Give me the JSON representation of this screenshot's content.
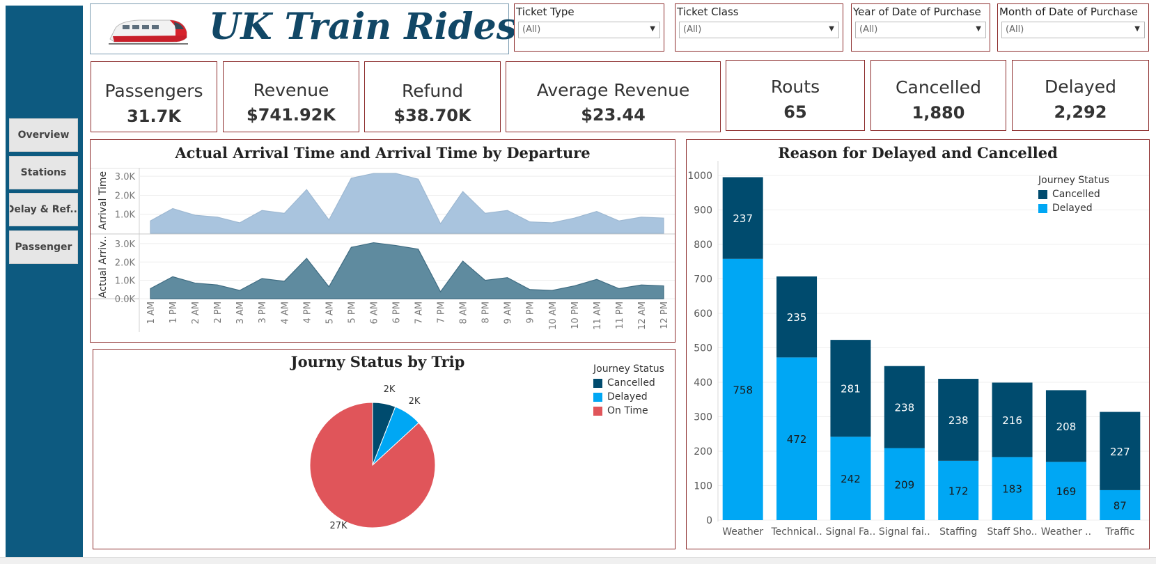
{
  "nav": {
    "items": [
      {
        "label": "Overview"
      },
      {
        "label": "Stations"
      },
      {
        "label": "Delay & Ref..."
      },
      {
        "label": "Passenger"
      }
    ]
  },
  "header": {
    "title": "UK Train Rides"
  },
  "filters": [
    {
      "label": "Ticket Type",
      "value": "(All)"
    },
    {
      "label": "Ticket Class",
      "value": "(All)"
    },
    {
      "label": "Year of Date of Purchase",
      "value": "(All)"
    },
    {
      "label": "Month of Date of Purchase",
      "value": "(All)"
    }
  ],
  "kpis": [
    {
      "label": "Passengers",
      "value": "31.7K"
    },
    {
      "label": "Revenue",
      "value": "$741.92K"
    },
    {
      "label": "Refund",
      "value": "$38.70K"
    },
    {
      "label": "Average Revenue",
      "value": "$23.44"
    },
    {
      "label": "Routs",
      "value": "65"
    },
    {
      "label": "Cancelled",
      "value": "1,880"
    },
    {
      "label": "Delayed",
      "value": "2,292"
    }
  ],
  "colors": {
    "sidebar": "#0d5a80",
    "cancelled": "#004b6e",
    "delayed": "#00a7f4",
    "on_time": "#e0555a",
    "area_light": "#a9c4de",
    "area_dark": "#5f8b9f"
  },
  "chart_data": [
    {
      "type": "area",
      "title": "Actual Arrival Time and Arrival Time by Departure",
      "categories": [
        "1 AM",
        "1 PM",
        "2 AM",
        "2 PM",
        "3 AM",
        "3 PM",
        "4 AM",
        "4 PM",
        "5 AM",
        "5 PM",
        "6 AM",
        "6 PM",
        "7 AM",
        "7 PM",
        "8 AM",
        "8 PM",
        "9 AM",
        "9 PM",
        "10 AM",
        "10 PM",
        "11 AM",
        "11 PM",
        "12 AM",
        "12 PM"
      ],
      "series": [
        {
          "name": "Arrival Time",
          "values": [
            650,
            1300,
            950,
            850,
            550,
            1200,
            1050,
            2300,
            700,
            2900,
            3150,
            3150,
            2850,
            500,
            2200,
            1050,
            1200,
            600,
            550,
            800,
            1150,
            650,
            850,
            800
          ]
        },
        {
          "name": "Actual Arrival Time",
          "values": [
            550,
            1200,
            850,
            750,
            450,
            1100,
            950,
            2200,
            650,
            2800,
            3050,
            2900,
            2700,
            380,
            2050,
            1000,
            1150,
            500,
            450,
            700,
            1050,
            550,
            750,
            700
          ]
        }
      ],
      "ylabel_top": "Arrival Time",
      "ylabel_bottom": "Actual Arriv..",
      "yticks_top": [
        "1.0K",
        "2.0K",
        "3.0K"
      ],
      "yticks_bottom": [
        "0.0K",
        "1.0K",
        "2.0K",
        "3.0K"
      ],
      "ylim": [
        0,
        3300
      ]
    },
    {
      "type": "pie",
      "title": "Journy Status by Trip",
      "legend_title": "Journey Status",
      "slices": [
        {
          "name": "Cancelled",
          "value": 1880,
          "label": "2K"
        },
        {
          "name": "Delayed",
          "value": 2292,
          "label": "2K"
        },
        {
          "name": "On Time",
          "value": 27481,
          "label": "27K"
        }
      ]
    },
    {
      "type": "bar",
      "stacked": true,
      "title": "Reason for Delayed and Cancelled",
      "legend_title": "Journey Status",
      "categories": [
        "Weather",
        "Technical..",
        "Signal Fa..",
        "Signal fai..",
        "Staffing",
        "Staff Sho..",
        "Weather ..",
        "Traffic"
      ],
      "series": [
        {
          "name": "Delayed",
          "values": [
            758,
            472,
            242,
            209,
            172,
            183,
            169,
            87
          ]
        },
        {
          "name": "Cancelled",
          "values": [
            237,
            235,
            281,
            238,
            238,
            216,
            208,
            227
          ]
        }
      ],
      "yticks": [
        0,
        100,
        200,
        300,
        400,
        500,
        600,
        700,
        800,
        900,
        1000
      ],
      "ylim": [
        0,
        1000
      ]
    }
  ]
}
